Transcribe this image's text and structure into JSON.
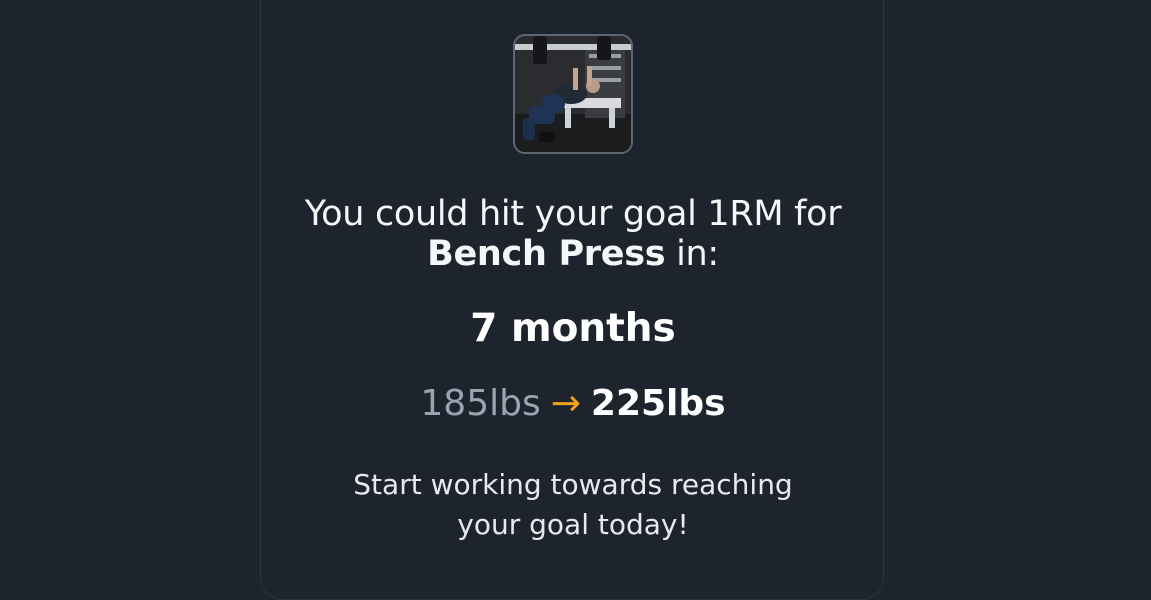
{
  "goal_card": {
    "exercise_image_alt": "Bench Press",
    "headline_prefix": "You could hit your goal 1RM for",
    "exercise_name": "Bench Press",
    "headline_suffix": "in:",
    "duration": "7 months",
    "current_weight": "185lbs",
    "arrow": "→",
    "goal_weight": "225lbs",
    "cta_text": "Start working towards reaching your goal today!"
  },
  "colors": {
    "background": "#1e242e",
    "accent_arrow": "#f0a21c",
    "muted_text": "#9aa4b1"
  }
}
